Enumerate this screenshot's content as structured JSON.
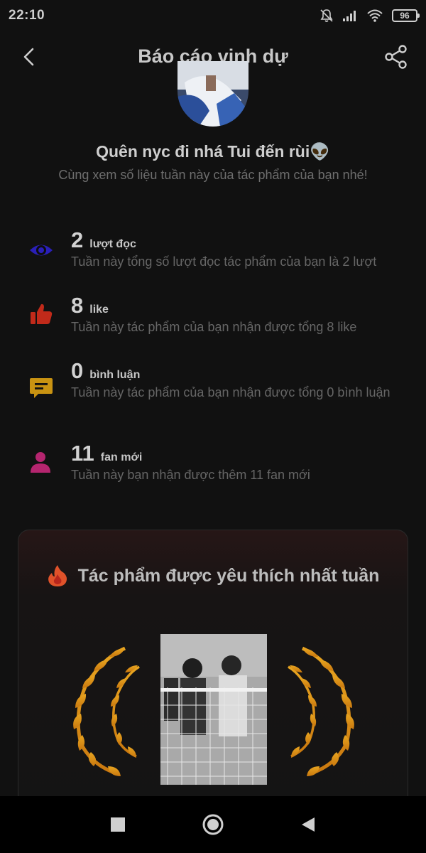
{
  "status_bar": {
    "time": "22:10",
    "battery": "96"
  },
  "header": {
    "title": "Báo cáo vinh dự"
  },
  "work": {
    "name": "Quên nyc đi nhá Tui đến rùi👽",
    "subtitle": "Cùng xem số liệu tuần này của tác phẩm của bạn nhé!"
  },
  "stats": [
    {
      "value": "2",
      "unit": "lượt đọc",
      "desc": "Tuần này tổng số lượt đọc tác phẩm của bạn là 2 lượt",
      "icon": "eye-icon",
      "color": "#2a1fb8"
    },
    {
      "value": "8",
      "unit": "like",
      "desc": "Tuần này tác phẩm của bạn nhận được tổng 8 like",
      "icon": "thumbs-up-icon",
      "color": "#c12a1a"
    },
    {
      "value": "0",
      "unit": "bình luận",
      "desc": "Tuần này tác phẩm của bạn nhận được tổng 0 bình luận",
      "icon": "comment-icon",
      "color": "#c99312"
    },
    {
      "value": "11",
      "unit": "fan mới",
      "desc": "Tuần này bạn nhận được thêm 11 fan mới",
      "icon": "person-icon",
      "color": "#b5256f"
    }
  ],
  "favorite_card": {
    "title": "Tác phẩm được yêu thích nhất tuần"
  },
  "colors": {
    "background": "#111111",
    "gold": "#d9951a",
    "flame": "#e0522a"
  }
}
